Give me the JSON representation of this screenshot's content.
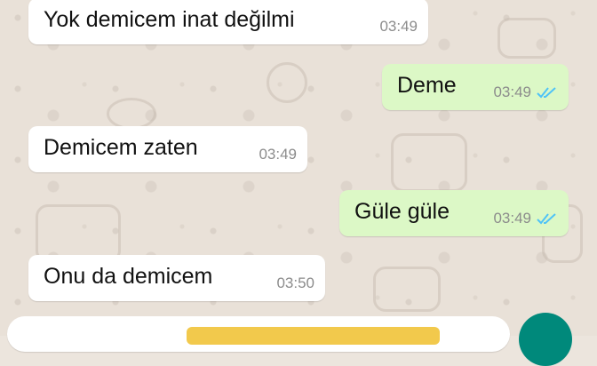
{
  "messages": [
    {
      "direction": "incoming",
      "text": "Yok demicem inat değilmi",
      "time": "03:49",
      "status_icon": ""
    },
    {
      "direction": "outgoing",
      "text": "Deme",
      "time": "03:49",
      "status_icon": "double-check-read-icon"
    },
    {
      "direction": "incoming",
      "text": "Demicem zaten",
      "time": "03:49",
      "status_icon": ""
    },
    {
      "direction": "outgoing",
      "text": "Güle güle",
      "time": "03:49",
      "status_icon": "double-check-read-icon"
    },
    {
      "direction": "incoming",
      "text": "Onu da demicem",
      "time": "03:50",
      "status_icon": ""
    }
  ],
  "colors": {
    "incoming_bubble": "#ffffff",
    "outgoing_bubble": "#dcf8c6",
    "read_ticks": "#4fc3f7",
    "send_button": "#00897b",
    "input_highlight": "#f2c94c"
  }
}
